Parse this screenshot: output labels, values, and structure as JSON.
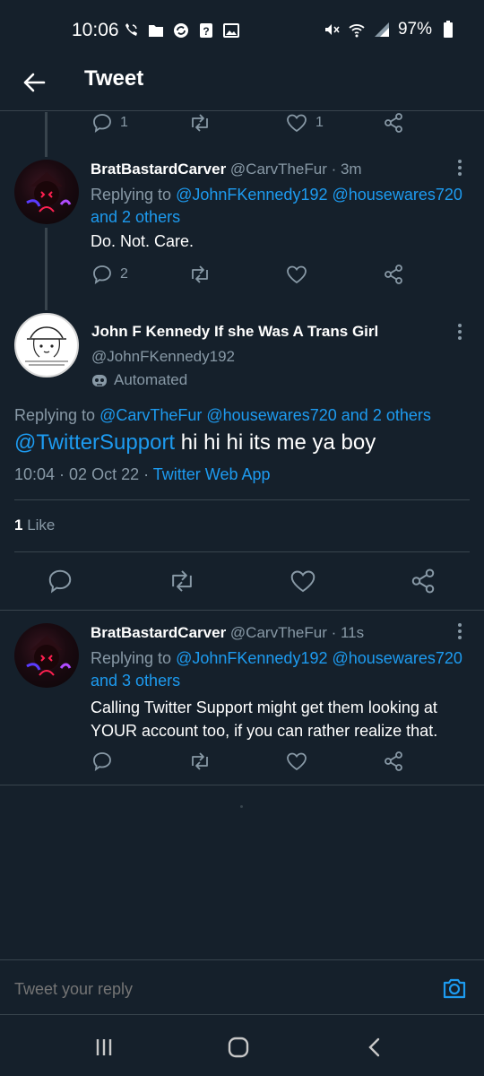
{
  "status_bar": {
    "time": "10:06",
    "battery": "97%",
    "left_icons": [
      "wifi-calling-icon",
      "folder-icon",
      "sync-app-icon",
      "question-icon",
      "image-icon"
    ],
    "right_icons": [
      "mute-icon",
      "wifi-icon",
      "signal-icon",
      "battery-icon"
    ]
  },
  "header": {
    "title": "Tweet"
  },
  "top_actions": {
    "reply_count": "1",
    "like_count": "1"
  },
  "tweet1": {
    "display_name": "BratBastardCarver",
    "handle_time": "@CarvTheFur · 3m",
    "replying_prefix": "Replying to",
    "reply_to_1": "@JohnFKennedy192",
    "reply_to_2": "@housewares720",
    "reply_to_more": "and 2 others",
    "text": "Do. Not. Care.",
    "reply_count": "2"
  },
  "main_tweet": {
    "display_name": "John F Kennedy If she Was A Trans Girl",
    "handle": "@JohnFKennedy192",
    "automated_label": "Automated",
    "replying_prefix": "Replying to",
    "reply_to_1": "@CarvTheFur",
    "reply_to_2": "@housewares720",
    "reply_to_more": "and 2 others",
    "mention": "@TwitterSupport",
    "text": "hi hi hi its me ya boy",
    "timestamp": "10:04 · 02 Oct 22 ·",
    "source": "Twitter Web App",
    "like_count": "1",
    "like_label": "Like"
  },
  "tweet3": {
    "display_name": "BratBastardCarver",
    "handle_time": "@CarvTheFur · 11s",
    "replying_prefix": "Replying to",
    "reply_to_1": "@JohnFKennedy192",
    "reply_to_2": "@housewares720",
    "reply_to_more": "and 3 others",
    "text_line1": "Calling Twitter Support might get them looking at",
    "text_line2": "YOUR account too, if you can rather realize that."
  },
  "reply_bar": {
    "placeholder": "Tweet your reply"
  },
  "colors": {
    "background": "#15202b",
    "accent": "#1d9bf0",
    "muted": "#8899a6",
    "border": "#38444d"
  }
}
